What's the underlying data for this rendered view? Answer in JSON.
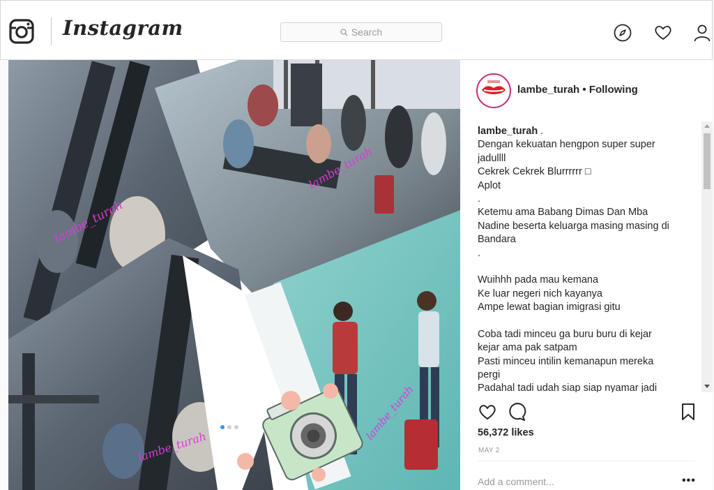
{
  "header": {
    "wordmark": "Instagram",
    "search_placeholder": "Search",
    "icons": [
      "instagram-logo-icon",
      "compass-icon",
      "heart-icon",
      "profile-icon"
    ]
  },
  "post": {
    "username": "lambe_turah",
    "separator": "•",
    "follow_status": "Following",
    "watermark": "lambe_turah",
    "caption": {
      "user": "lambe_turah",
      "lines": [
        ".",
        "Dengan kekuatan hengpon super super",
        "jadullll",
        "Cekrek Cekrek Blurrrrrr □",
        "Aplot",
        ".",
        "Ketemu ama Babang Dimas Dan Mba",
        "Nadine beserta keluarga masing masing di",
        "Bandara",
        ".",
        "",
        "Wuihhh pada mau kemana",
        "Ke luar negeri nich kayanya",
        "Ampe lewat bagian imigrasi gitu",
        "",
        "Coba tadi minceu ga buru buru di kejar",
        "kejar ama pak satpam",
        "Pasti minceu intilin kemanapun mereka",
        "pergi",
        "Padahal tadi udah siap siap nyamar jadi"
      ]
    },
    "likes": "56,372 likes",
    "date": "MAY 2",
    "comment_placeholder": "Add a comment...",
    "more_label": "•••",
    "carousel_dots": 3,
    "colors": {
      "avatar_ring": "#c72a7b",
      "active_dot": "#3897f0",
      "watermark": "#d93bd9"
    }
  }
}
